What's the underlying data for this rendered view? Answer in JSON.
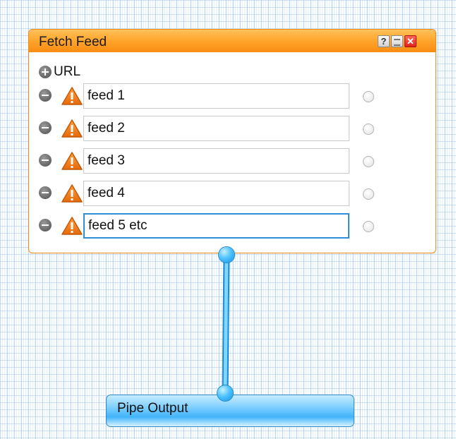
{
  "module": {
    "title": "Fetch Feed",
    "help_label": "?",
    "url_label": "URL",
    "feeds": [
      {
        "value": "feed 1"
      },
      {
        "value": "feed 2"
      },
      {
        "value": "feed 3"
      },
      {
        "value": "feed 4"
      },
      {
        "value": "feed 5 etc"
      }
    ]
  },
  "output": {
    "title": "Pipe Output"
  },
  "colors": {
    "module_header": "#ffa52a",
    "module_border": "#f08a1c",
    "output_fill": "#42b4fb",
    "wire": "#3ab8ff",
    "focus_border": "#2e8fd6"
  },
  "icons": [
    "help-icon",
    "minimize-icon",
    "close-icon",
    "add-icon",
    "remove-icon",
    "warning-icon",
    "terminal-port-icon"
  ]
}
